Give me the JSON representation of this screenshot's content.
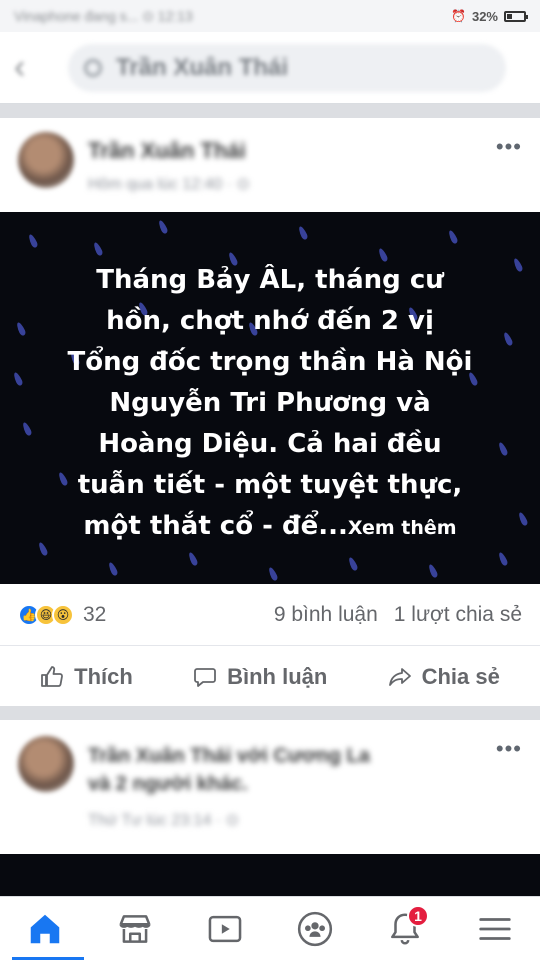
{
  "status_bar": {
    "left_text": "Vinaphone đang s... ⊙ 12:13",
    "battery": "32%",
    "battery_level": 0.32
  },
  "search": {
    "query": "Trần Xuân Thái"
  },
  "post": {
    "author": "Trần Xuân Thái",
    "time": "Hôm qua lúc 12:40 · ⊙",
    "text_lines": [
      "Tháng Bảy ÂL, tháng cư",
      "hồn, chợt nhớ đến 2 vị",
      "Tổng đốc trọng thần Hà Nội",
      "Nguyễn Tri Phương và",
      "Hoàng Diệu. Cả hai đều",
      "tuẫn tiết - một tuyệt thực,",
      "một thắt cổ - để..."
    ],
    "see_more": "Xem thêm",
    "reaction_count": "32",
    "comments": "9 bình luận",
    "shares": "1 lượt chia sẻ",
    "actions": {
      "like": "Thích",
      "comment": "Bình luận",
      "share": "Chia sẻ"
    }
  },
  "post2": {
    "author_line1": "Trần Xuân Thái với Cương La",
    "author_line2": "và 2 người khác.",
    "time": "Thứ Tư lúc 23:14 · ⊙"
  },
  "bottom_nav": {
    "notification_badge": "1"
  },
  "colors": {
    "facebook_blue": "#1877f2",
    "badge_red": "#e41e3f",
    "image_background": "#07090f",
    "raindrop": "#4a56c8"
  }
}
